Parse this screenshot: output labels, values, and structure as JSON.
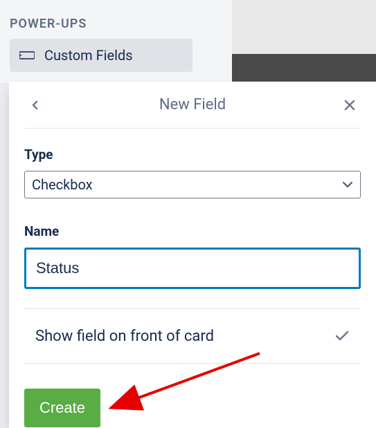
{
  "sidebar": {
    "heading": "POWER-UPS",
    "item_label": "Custom Fields"
  },
  "modal": {
    "title": "New Field",
    "type_label": "Type",
    "type_value": "Checkbox",
    "name_label": "Name",
    "name_value": "Status",
    "toggle_label": "Show field on front of card",
    "create_label": "Create"
  }
}
